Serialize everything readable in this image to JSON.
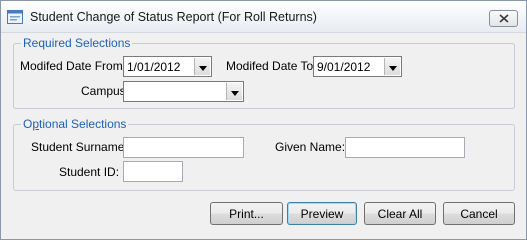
{
  "window": {
    "title": "Student Change of Status Report (For Roll Returns)"
  },
  "required": {
    "legend": "Required Selections",
    "date_from_label": "Modifed Date From:",
    "date_from_value": "1/01/2012",
    "date_to_label": "Modifed Date To:",
    "date_to_value": "9/01/2012",
    "campus_label": "Campus",
    "campus_value": ""
  },
  "optional": {
    "legend_prefix": "O",
    "legend_underlined": "p",
    "legend_rest": "tional Selections",
    "surname_label": "Student Surname:",
    "surname_value": "",
    "given_label": "Given Name:",
    "given_value": "",
    "id_label": "Student ID:",
    "id_value": ""
  },
  "buttons": {
    "print": "Print...",
    "preview": "Preview",
    "clear": "Clear All",
    "cancel": "Cancel"
  },
  "icons": {
    "app": "form-icon",
    "close": "close-icon",
    "dropdown": "chevron-down-icon"
  },
  "colors": {
    "legend": "#1f5fbf",
    "dialog_bg": "#f0f0f0",
    "default_button_border": "#3c7fb1"
  }
}
